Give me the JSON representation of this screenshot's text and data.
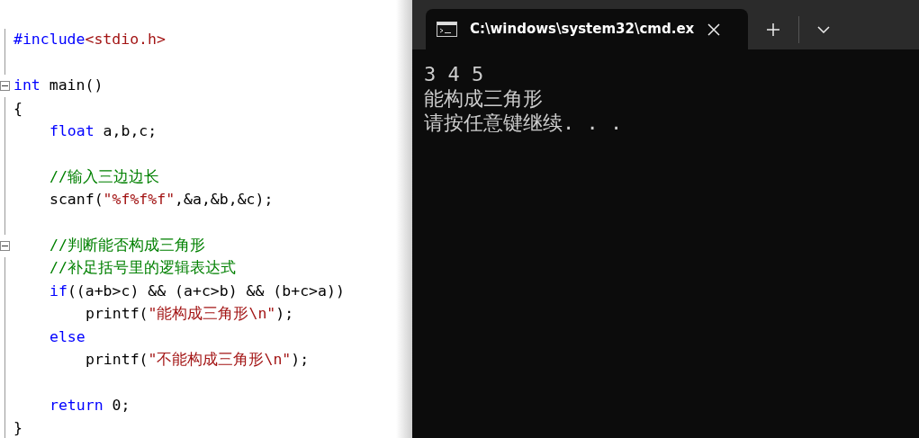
{
  "editor": {
    "lines": [
      {
        "kind": "code",
        "fold": false,
        "tokens": [
          {
            "kind": "keyword",
            "text": "#include"
          },
          {
            "kind": "string",
            "text": "<stdio.h>"
          }
        ]
      },
      {
        "kind": "blank",
        "fold": false
      },
      {
        "kind": "code",
        "fold": true,
        "tokens": [
          {
            "kind": "keyword",
            "text": "int"
          },
          {
            "kind": "plain",
            "text": " main()"
          }
        ]
      },
      {
        "kind": "code",
        "fold": false,
        "tokens": [
          {
            "kind": "plain",
            "text": "{"
          }
        ],
        "children": [
          {
            "kind": "code",
            "fold": false,
            "tokens": [
              {
                "kind": "keyword",
                "text": "float"
              },
              {
                "kind": "plain",
                "text": " a,b,c;"
              }
            ]
          },
          {
            "kind": "blank",
            "fold": false
          },
          {
            "kind": "code",
            "fold": false,
            "tokens": [
              {
                "kind": "comment",
                "text": "//输入三边边长"
              }
            ]
          },
          {
            "kind": "code",
            "fold": false,
            "tokens": [
              {
                "kind": "plain",
                "text": "scanf("
              },
              {
                "kind": "string",
                "text": "\"%f%f%f\""
              },
              {
                "kind": "plain",
                "text": ",&a,&b,&c);"
              }
            ]
          },
          {
            "kind": "blank",
            "fold": false
          },
          {
            "kind": "code",
            "fold": true,
            "tokens": [
              {
                "kind": "comment",
                "text": "//判断能否构成三角形"
              }
            ]
          },
          {
            "kind": "code",
            "fold": false,
            "tokens": [
              {
                "kind": "comment",
                "text": "//补足括号里的逻辑表达式"
              }
            ]
          },
          {
            "kind": "code",
            "fold": false,
            "tokens": [
              {
                "kind": "keyword",
                "text": "if"
              },
              {
                "kind": "plain",
                "text": "((a+b>c) && (a+c>b) && (b+c>a))"
              }
            ],
            "children": [
              {
                "kind": "code",
                "fold": false,
                "tokens": [
                  {
                    "kind": "plain",
                    "text": "printf("
                  },
                  {
                    "kind": "string",
                    "text": "\"能构成三角形\\n\""
                  },
                  {
                    "kind": "plain",
                    "text": ");"
                  }
                ]
              }
            ]
          },
          {
            "kind": "code",
            "fold": false,
            "tokens": [
              {
                "kind": "keyword",
                "text": "else"
              }
            ],
            "children": [
              {
                "kind": "code",
                "fold": false,
                "tokens": [
                  {
                    "kind": "plain",
                    "text": "printf("
                  },
                  {
                    "kind": "string",
                    "text": "\"不能构成三角形\\n\""
                  },
                  {
                    "kind": "plain",
                    "text": ");"
                  }
                ]
              }
            ]
          },
          {
            "kind": "blank",
            "fold": false
          },
          {
            "kind": "code",
            "fold": false,
            "tokens": [
              {
                "kind": "keyword",
                "text": "return"
              },
              {
                "kind": "plain",
                "text": " 0;"
              }
            ]
          }
        ]
      },
      {
        "kind": "code",
        "fold": false,
        "tokens": [
          {
            "kind": "plain",
            "text": "}"
          }
        ]
      }
    ]
  },
  "terminal": {
    "tab": {
      "title": "C:\\windows\\system32\\cmd.ex",
      "selected": true
    },
    "output": [
      "3 4 5",
      "能构成三角形",
      "请按任意键继续. . ."
    ]
  }
}
